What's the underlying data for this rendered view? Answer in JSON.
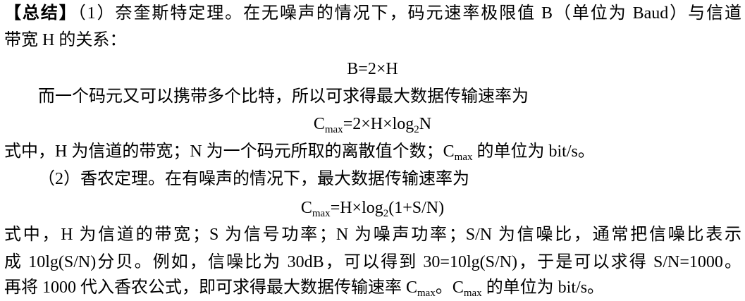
{
  "summary": {
    "heading": "【总结】",
    "nyquist": {
      "intro_line1": "（1）奈奎斯特定理。在无噪声的情况下，码元速率极限值 B（单位为 Baud）与信道",
      "intro_line2": "带宽 H 的关系：",
      "formula1": "B=2×H",
      "para2": "而一个码元又可以携带多个比特，所以可求得最大数据传输速率为",
      "formula2": {
        "c": "C",
        "sub_max": "max",
        "eq": "=2×H×log",
        "sub_2": "2",
        "tail": "N"
      },
      "explain": {
        "before": "式中，H 为信道的带宽；N 为一个码元所取的离散值个数；C",
        "sub": "max",
        "after": " 的单位为 bit/s。"
      }
    },
    "shannon": {
      "intro": "（2）香农定理。在有噪声的情况下，最大数据传输速率为",
      "formula": {
        "c": "C",
        "sub_max": "max",
        "eq": "=H×log",
        "sub_2": "2",
        "tail": "(1+S/N)"
      },
      "explain_line1": "式中，H 为信道的带宽；S 为信号功率；N 为噪声功率；S/N 为信噪比，通常把信噪比表示",
      "explain_line2": "成 10lg(S/N)分贝。例如，信噪比为 30dB，可以得到 30=10lg(S/N)，于是可以求得 S/N=1000。",
      "explain_line3": {
        "before": "再将 1000 代入香农公式，即可求得最大数据传输速率 C",
        "sub1": "max",
        "mid": "。C",
        "sub2": "max",
        "after": " 的单位为 bit/s。"
      }
    }
  }
}
